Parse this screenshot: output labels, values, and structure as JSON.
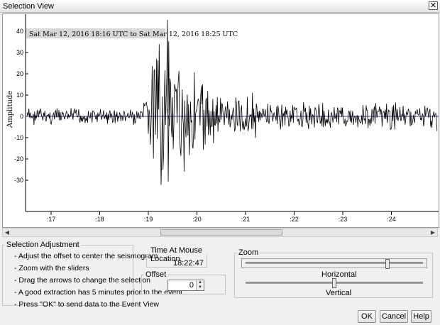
{
  "window": {
    "title": "Selection View",
    "close_glyph": "✕"
  },
  "plot": {
    "date_range": "Sat Mar 12, 2016 18:16 UTC to Sat Mar 12, 2016 18:25 UTC",
    "y_axis_label": "Amplitude",
    "y_ticks": [
      "40",
      "30",
      "20",
      "10",
      "0",
      "-10",
      "-20",
      "-30"
    ],
    "x_ticks": [
      ":17",
      ":18",
      ":19",
      ":20",
      ":21",
      ":22",
      ":23",
      ":24"
    ]
  },
  "selection_adjustment": {
    "title": "Selection Adjustment",
    "instructions": [
      "- Adjust the offset to center the seismogram",
      "- Zoom with the sliders",
      "- Drag the arrows to change the selection",
      "- A good extraction has 5 minutes prior to the event",
      "- Press \"OK\" to send data to the Event View"
    ]
  },
  "mouse_location": {
    "title": "Time At Mouse Location",
    "value": "18:22:47"
  },
  "offset": {
    "title": "Offset",
    "value": "0"
  },
  "zoom": {
    "title": "Zoom",
    "horizontal_label": "Horizontal",
    "vertical_label": "Vertical",
    "horizontal_level": 0.8,
    "vertical_level": 0.5
  },
  "buttons": {
    "ok": "OK",
    "cancel": "Cancel",
    "help": "Help"
  },
  "colors": {
    "trace": "#000000",
    "zero_line": "#1f3fbf",
    "label_bg": "#d7d7d7",
    "panel": "#f0f0f0"
  }
}
